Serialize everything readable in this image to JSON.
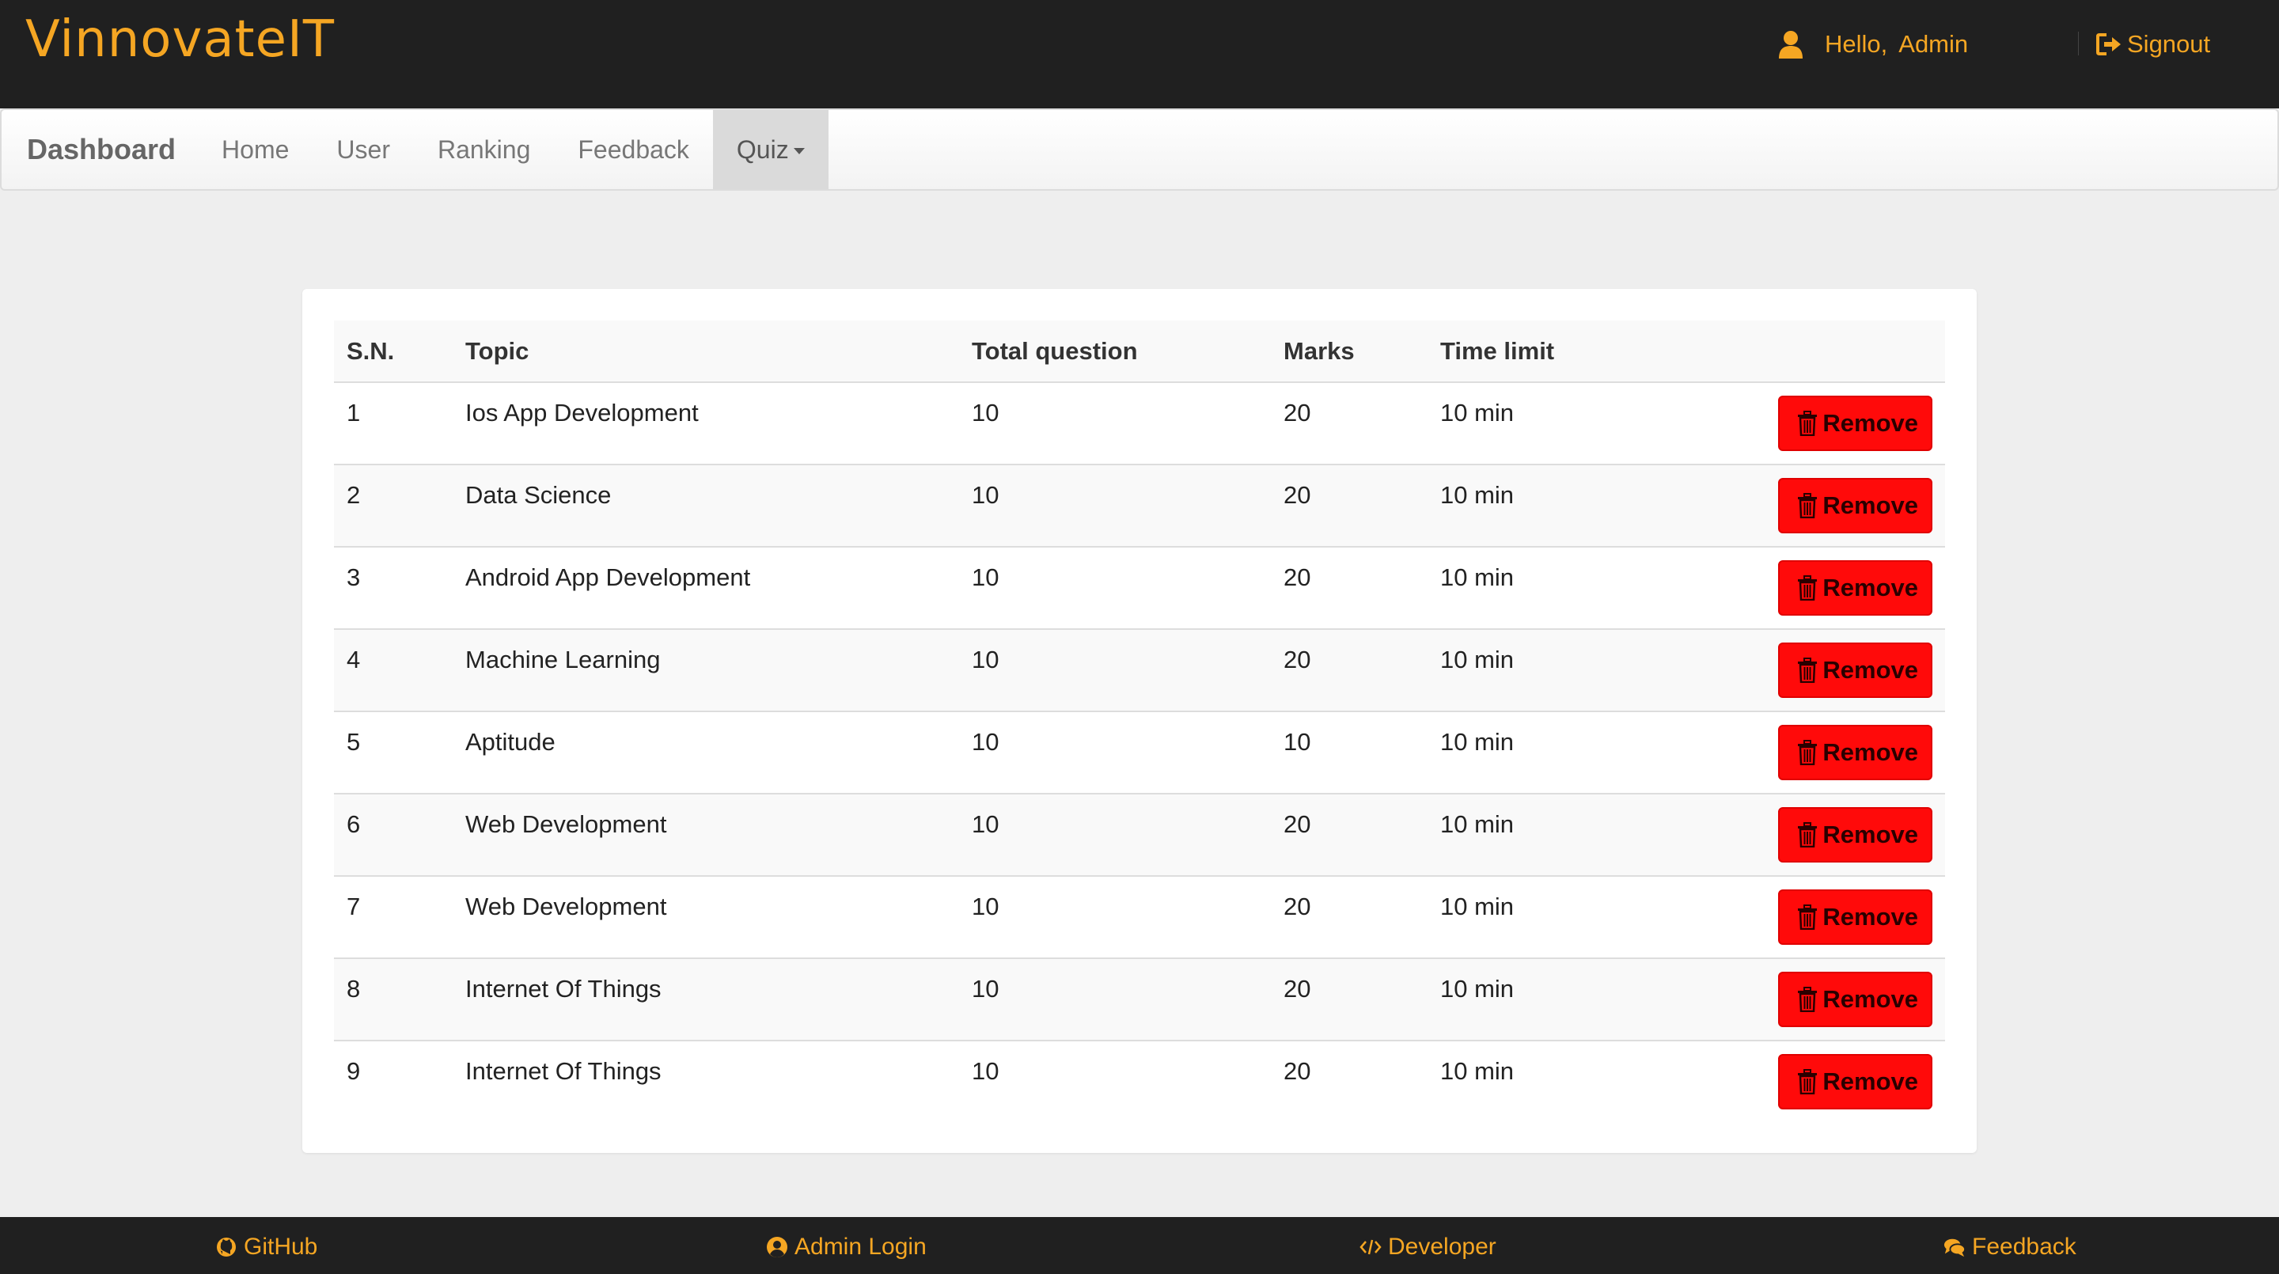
{
  "header": {
    "brand": "VinnovateIT",
    "greeting": "Hello,",
    "user": "Admin",
    "signout": "Signout"
  },
  "nav": {
    "brand": "Dashboard",
    "items": [
      "Home",
      "User",
      "Ranking",
      "Feedback"
    ],
    "quiz": "Quiz"
  },
  "table": {
    "headers": [
      "S.N.",
      "Topic",
      "Total question",
      "Marks",
      "Time limit"
    ],
    "remove_label": "Remove",
    "rows": [
      {
        "sn": "1",
        "topic": "Ios App Development",
        "total": "10",
        "marks": "20",
        "time": "10 min"
      },
      {
        "sn": "2",
        "topic": "Data Science",
        "total": "10",
        "marks": "20",
        "time": "10 min"
      },
      {
        "sn": "3",
        "topic": "Android App Development",
        "total": "10",
        "marks": "20",
        "time": "10 min"
      },
      {
        "sn": "4",
        "topic": "Machine Learning",
        "total": "10",
        "marks": "20",
        "time": "10 min"
      },
      {
        "sn": "5",
        "topic": "Aptitude",
        "total": "10",
        "marks": "10",
        "time": "10 min"
      },
      {
        "sn": "6",
        "topic": "Web Development",
        "total": "10",
        "marks": "20",
        "time": "10 min"
      },
      {
        "sn": "7",
        "topic": "Web Development",
        "total": "10",
        "marks": "20",
        "time": "10 min"
      },
      {
        "sn": "8",
        "topic": "Internet Of Things",
        "total": "10",
        "marks": "20",
        "time": "10 min"
      },
      {
        "sn": "9",
        "topic": "Internet Of Things",
        "total": "10",
        "marks": "20",
        "time": "10 min"
      }
    ]
  },
  "footer": {
    "github": "GitHub",
    "admin_login": "Admin Login",
    "developer": "Developer",
    "feedback": "Feedback"
  },
  "colors": {
    "accent": "#f5a623",
    "header_bg": "#202020",
    "danger": "#ff0a0a"
  },
  "icons": [
    "user-icon",
    "signout-icon",
    "trash-icon",
    "github-icon",
    "user-circle-icon",
    "code-icon",
    "comments-icon"
  ]
}
